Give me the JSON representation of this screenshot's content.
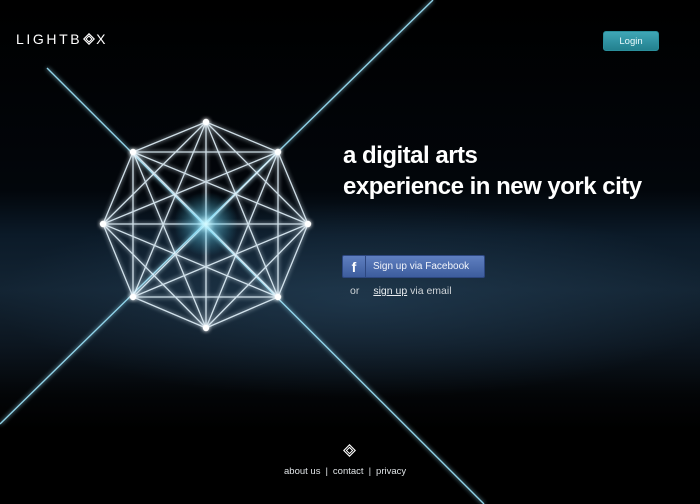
{
  "header": {
    "logo_text_before": "LIGHTB",
    "logo_text_after": "X",
    "login_label": "Login"
  },
  "hero": {
    "headline_line1": "a digital arts",
    "headline_line2": "experience in new york city"
  },
  "signup": {
    "facebook_icon": "f",
    "facebook_label": "Sign up via Facebook",
    "or_text": "or",
    "email_link": "sign up",
    "email_suffix": " via email"
  },
  "footer": {
    "links": [
      "about us",
      "contact",
      "privacy"
    ],
    "separator": "|"
  },
  "colors": {
    "login_button": "#2e96a4",
    "facebook_button": "#4a69ad",
    "glow": "#9fe8ff"
  }
}
